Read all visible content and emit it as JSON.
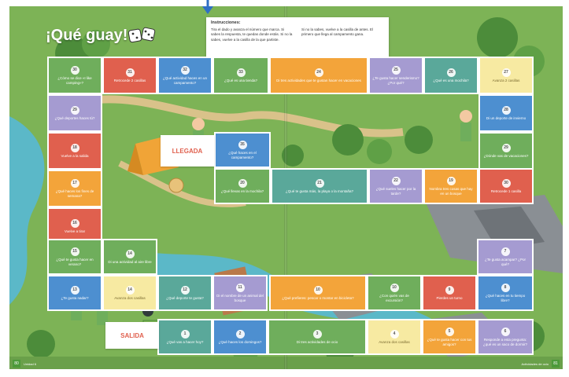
{
  "title": "¡Qué guay!",
  "instructions": {
    "heading": "Instrucciones:",
    "col1": "Tira el dado y avanza el número que marca. Si sabes la respuesta, te quedas donde estás. Si no la sabes, vuelve a la casilla de la que partiste.",
    "col2": "Si no la sabes, vuelve a la casilla de antes. El primero que llega al campamento gana."
  },
  "labels": {
    "start": "SALIDA",
    "finish": "LLEGADA"
  },
  "footer": {
    "left_page": "80",
    "left_section": "Unidad 6",
    "right_page": "81",
    "right_section": "Actividades de ocio"
  },
  "squares": [
    {
      "n": "30",
      "t": "¿Cómo se dice «I like camping»?",
      "color": "green"
    },
    {
      "n": "31",
      "t": "Retrocede 2 casillas",
      "color": "red"
    },
    {
      "n": "32",
      "t": "¿Qué actividad haces en un campamento?",
      "color": "blue"
    },
    {
      "n": "33",
      "t": "¿Qué es una tienda?",
      "color": "green"
    },
    {
      "n": "24",
      "t": "Di tres actividades que te gustan hacer en vacaciones",
      "color": "orange"
    },
    {
      "n": "25",
      "t": "¿Te gusta hacer senderismo? ¿Por qué?",
      "color": "purple"
    },
    {
      "n": "26",
      "t": "¿Qué es una mochila?",
      "color": "teal"
    },
    {
      "n": "27",
      "t": "Avanza 2 casillas",
      "color": "yellow"
    },
    {
      "n": "29",
      "t": "¿Qué deportes haces tú?",
      "color": "purple"
    },
    {
      "n": "28",
      "t": "Di un deporte de invierno",
      "color": "blue"
    },
    {
      "n": "18",
      "t": "Vuelve a la salida",
      "color": "red"
    },
    {
      "n": "29",
      "t": "¿Dónde vas de vacaciones?",
      "color": "green"
    },
    {
      "n": "17",
      "t": "¿Qué haces los fines de semana?",
      "color": "orange"
    },
    {
      "n": "16",
      "t": "Vuelve a tirar",
      "color": "red"
    },
    {
      "n": "15",
      "t": "¿Qué te gusta hacer en verano?",
      "color": "green"
    },
    {
      "n": "14",
      "t": "Di una actividad al aire libre",
      "color": "green"
    },
    {
      "n": "35",
      "t": "¿Qué haces en el campamento?",
      "color": "blue"
    },
    {
      "n": "20",
      "t": "¿Qué llevas en la mochila?",
      "color": "green"
    },
    {
      "n": "21",
      "t": "¿Qué te gusta más, la playa o la montaña?",
      "color": "teal"
    },
    {
      "n": "22",
      "t": "¿Qué sueles hacer por la tarde?",
      "color": "purple"
    },
    {
      "n": "19",
      "t": "Nombra tres cosas que hay en un bosque",
      "color": "orange"
    },
    {
      "n": "30",
      "t": "Retrocede 1 casilla",
      "color": "red"
    },
    {
      "n": "13",
      "t": "¿Te gusta nadar?",
      "color": "blue"
    },
    {
      "n": "14",
      "t": "Avanza dos casillas",
      "color": "yellow"
    },
    {
      "n": "12",
      "t": "¿Qué deporte te gusta?",
      "color": "teal"
    },
    {
      "n": "11",
      "t": "Di el nombre de un animal del bosque",
      "color": "purple"
    },
    {
      "n": "10",
      "t": "¿Qué prefieres: pescar o montar en bicicleta?",
      "color": "orange"
    },
    {
      "n": "10",
      "t": "¿Con quién vas de excursión?",
      "color": "green"
    },
    {
      "n": "9",
      "t": "Pierdes un turno",
      "color": "red"
    },
    {
      "n": "8",
      "t": "¿Qué haces en tu tiempo libre?",
      "color": "blue"
    },
    {
      "n": "7",
      "t": "¿Te gusta acampar? ¿Por qué?",
      "color": "purple"
    },
    {
      "n": "1",
      "t": "¿Qué vas a hacer hoy?",
      "color": "teal"
    },
    {
      "n": "2",
      "t": "¿Qué haces los domingos?",
      "color": "blue"
    },
    {
      "n": "3",
      "t": "Di tres actividades de ocio",
      "color": "green"
    },
    {
      "n": "4",
      "t": "Avanza dos casillas",
      "color": "yellow"
    },
    {
      "n": "5",
      "t": "¿Qué te gusta hacer con tus amigos?",
      "color": "orange"
    },
    {
      "n": "6",
      "t": "Responde a esta pregunta: ¿qué es un saco de dormir?",
      "color": "purple"
    }
  ]
}
